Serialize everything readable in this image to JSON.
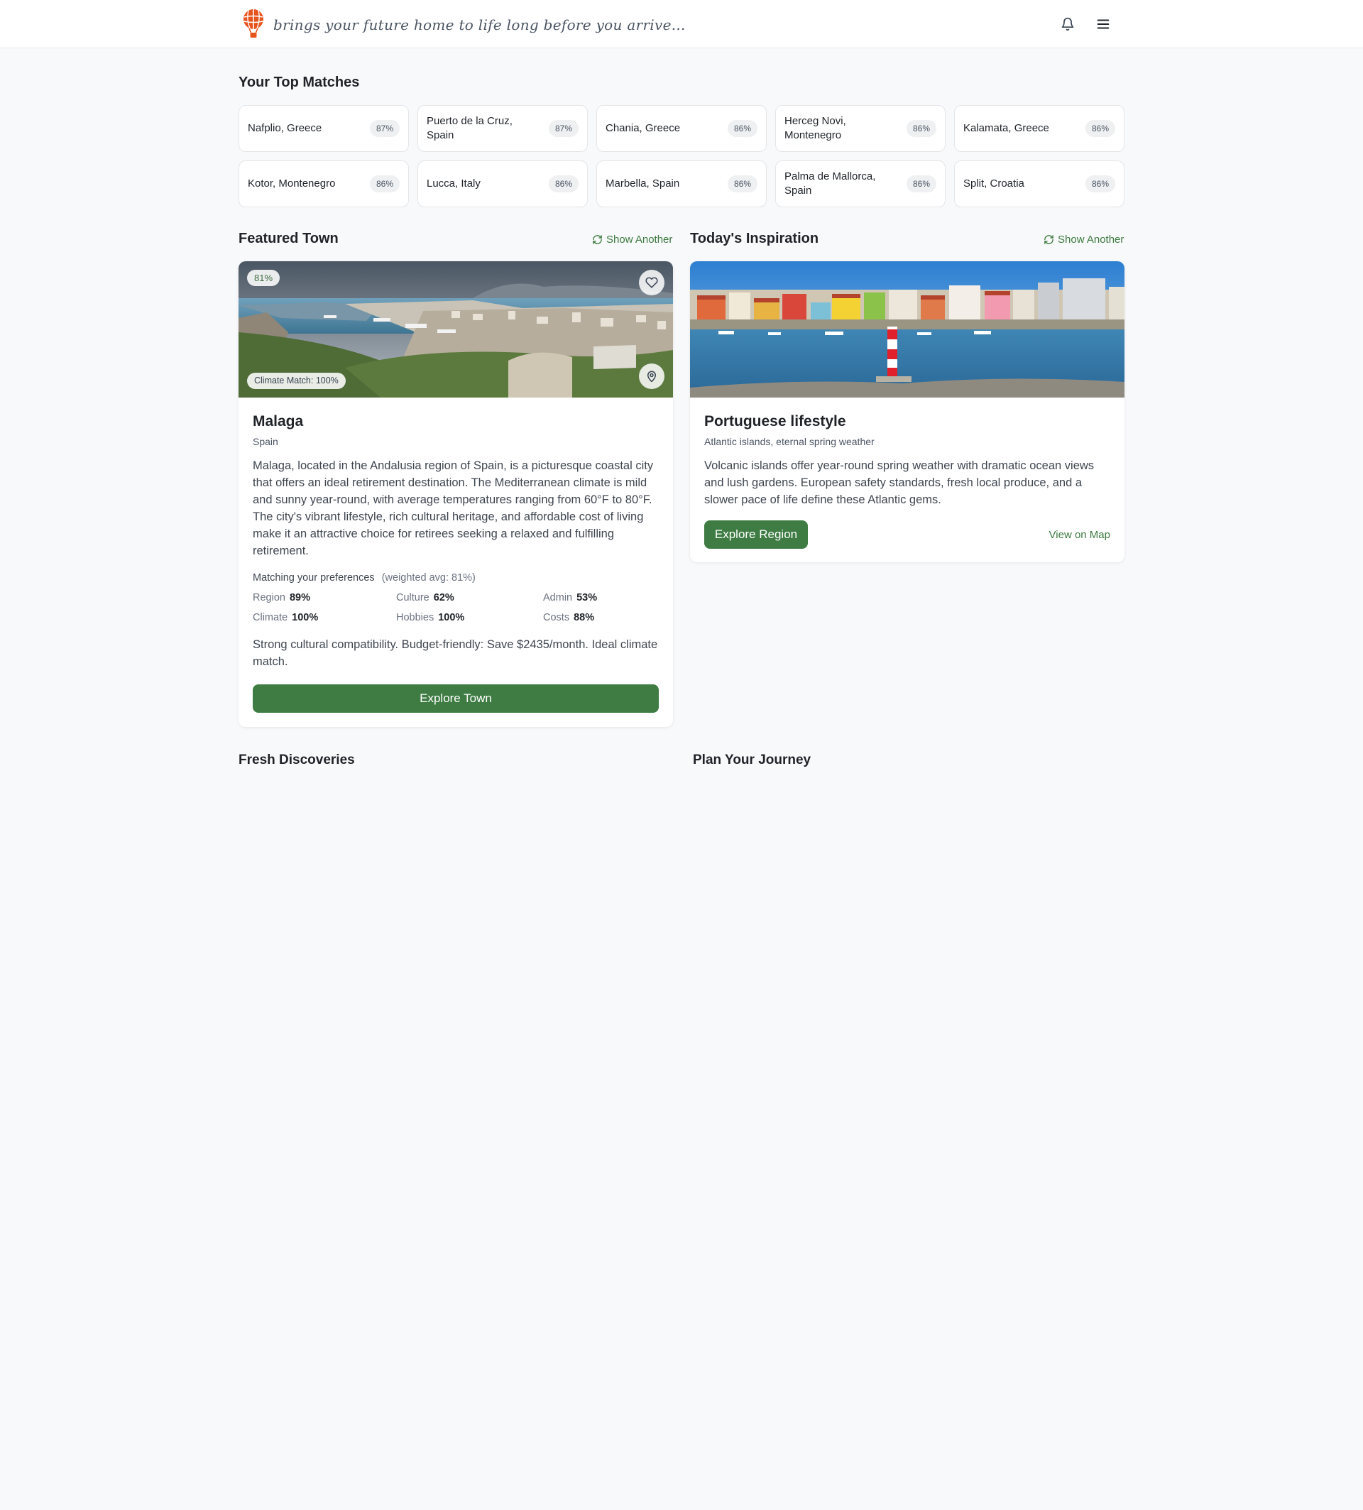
{
  "header": {
    "tagline": "brings your future home to life long before you arrive...",
    "brand_color": "#e8531d"
  },
  "top_matches": {
    "title": "Your Top Matches",
    "items": [
      {
        "name": "Nafplio, Greece",
        "match": "87%"
      },
      {
        "name": "Puerto de la Cruz, Spain",
        "match": "87%"
      },
      {
        "name": "Chania, Greece",
        "match": "86%"
      },
      {
        "name": "Herceg Novi, Montenegro",
        "match": "86%"
      },
      {
        "name": "Kalamata, Greece",
        "match": "86%"
      },
      {
        "name": "Kotor, Montenegro",
        "match": "86%"
      },
      {
        "name": "Lucca, Italy",
        "match": "86%"
      },
      {
        "name": "Marbella, Spain",
        "match": "86%"
      },
      {
        "name": "Palma de Mallorca, Spain",
        "match": "86%"
      },
      {
        "name": "Split, Croatia",
        "match": "86%"
      }
    ]
  },
  "featured": {
    "section_title": "Featured Town",
    "show_another": "Show Another",
    "match_badge": "81%",
    "climate_badge": "Climate Match: 100%",
    "name": "Malaga",
    "country": "Spain",
    "description": "Malaga, located in the Andalusia region of Spain, is a picturesque coastal city that offers an ideal retirement destination. The Mediterranean climate is mild and sunny year-round, with average temperatures ranging from 60°F to 80°F. The city's vibrant lifestyle, rich cultural heritage, and affordable cost of living make it an attractive choice for retirees seeking a relaxed and fulfilling retirement.",
    "prefs_heading": "Matching your preferences",
    "prefs_avg": "(weighted avg: 81%)",
    "prefs": [
      {
        "label": "Region",
        "value": "89%"
      },
      {
        "label": "Culture",
        "value": "62%"
      },
      {
        "label": "Admin",
        "value": "53%"
      },
      {
        "label": "Climate",
        "value": "100%"
      },
      {
        "label": "Hobbies",
        "value": "100%"
      },
      {
        "label": "Costs",
        "value": "88%"
      }
    ],
    "summary": "Strong cultural compatibility. Budget-friendly: Save $2435/month. Ideal climate match.",
    "button": "Explore Town"
  },
  "inspiration": {
    "section_title": "Today's Inspiration",
    "show_another": "Show Another",
    "title": "Portuguese lifestyle",
    "subtitle": "Atlantic islands, eternal spring weather",
    "description": "Volcanic islands offer year-round spring weather with dramatic ocean views and lush gardens. European safety standards, fresh local produce, and a slower pace of life define these Atlantic gems.",
    "button": "Explore Region",
    "map_link": "View on Map"
  },
  "lower_sections": {
    "fresh": "Fresh Discoveries",
    "journey": "Plan Your Journey"
  },
  "colors": {
    "accent_green": "#3f7c44",
    "link_green": "#3c7a3f",
    "page_bg": "#f8f9fa"
  },
  "icons": [
    "balloon-logo-icon",
    "bell-icon",
    "menu-icon",
    "refresh-icon",
    "heart-icon",
    "map-pin-icon"
  ]
}
